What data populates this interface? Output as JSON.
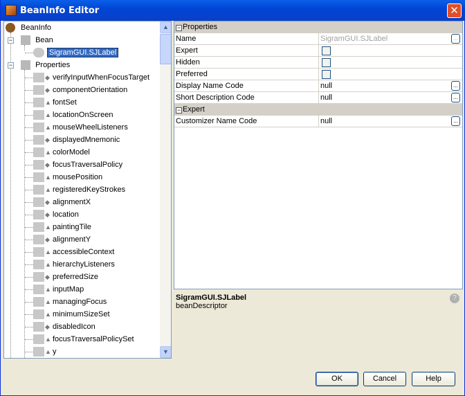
{
  "window": {
    "title": "BeanInfo Editor",
    "close": "✕"
  },
  "tree": {
    "root": "BeanInfo",
    "bean": "Bean",
    "bean_child": "SigramGUI.SJLabel",
    "properties": "Properties",
    "items": [
      {
        "label": "verifyInputWhenFocusTarget",
        "access": "read-write"
      },
      {
        "label": "componentOrientation",
        "access": "read-write"
      },
      {
        "label": "fontSet",
        "access": "read-only"
      },
      {
        "label": "locationOnScreen",
        "access": "read-only"
      },
      {
        "label": "mouseWheelListeners",
        "access": "read-only"
      },
      {
        "label": "displayedMnemonic",
        "access": "read-write"
      },
      {
        "label": "colorModel",
        "access": "read-only"
      },
      {
        "label": "focusTraversalPolicy",
        "access": "read-write"
      },
      {
        "label": "mousePosition",
        "access": "read-only"
      },
      {
        "label": "registeredKeyStrokes",
        "access": "read-only"
      },
      {
        "label": "alignmentX",
        "access": "read-write"
      },
      {
        "label": "location",
        "access": "read-write"
      },
      {
        "label": "paintingTile",
        "access": "read-only"
      },
      {
        "label": "alignmentY",
        "access": "read-write"
      },
      {
        "label": "accessibleContext",
        "access": "read-only"
      },
      {
        "label": "hierarchyListeners",
        "access": "read-only"
      },
      {
        "label": "preferredSize",
        "access": "read-write"
      },
      {
        "label": "inputMap",
        "access": "read-only"
      },
      {
        "label": "managingFocus",
        "access": "read-only"
      },
      {
        "label": "minimumSizeSet",
        "access": "read-only"
      },
      {
        "label": "disabledIcon",
        "access": "read-write"
      },
      {
        "label": "focusTraversalPolicySet",
        "access": "read-only"
      },
      {
        "label": "y",
        "access": "read-only"
      }
    ]
  },
  "sheet": {
    "cat_properties": "Properties",
    "name_label": "Name",
    "name_value": "SigramGUI.SJLabel",
    "expert_label": "Expert",
    "expert_checked": false,
    "hidden_label": "Hidden",
    "hidden_checked": false,
    "preferred_label": "Preferred",
    "preferred_checked": false,
    "display_label": "Display Name Code",
    "display_value": "null",
    "short_label": "Short Description Code",
    "short_value": "null",
    "cat_expert": "Expert",
    "customizer_label": "Customizer Name Code",
    "customizer_value": "null",
    "ellipsis": "..."
  },
  "description": {
    "title": "SigramGUI.SJLabel",
    "text": "beanDescriptor",
    "help": "?"
  },
  "buttons": {
    "ok": "OK",
    "cancel": "Cancel",
    "help": "Help"
  }
}
